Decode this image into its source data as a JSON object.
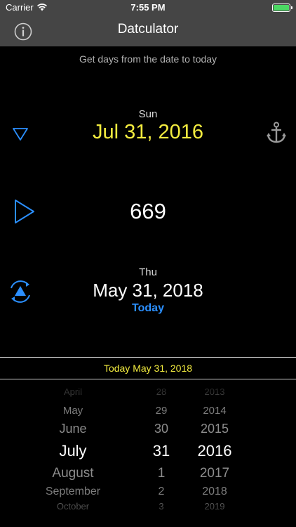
{
  "status_bar": {
    "carrier": "Carrier",
    "time": "7:55 PM",
    "battery_color": "#4cd964"
  },
  "nav_bar": {
    "title": "Datculator",
    "left_icon": "info-icon"
  },
  "subtitle": "Get days from the date to today",
  "start": {
    "weekday": "Sun",
    "date": "Jul 31, 2016",
    "left_icon": "down-triangle-icon",
    "right_icon": "anchor-icon"
  },
  "result": {
    "days": "669",
    "icon": "play-icon"
  },
  "end": {
    "weekday": "Thu",
    "date": "May 31, 2018",
    "today_label": "Today",
    "icon": "refresh-up-icon"
  },
  "today_bar": {
    "text": "Today May 31, 2018"
  },
  "picker": {
    "rows": [
      {
        "month": "April",
        "day": "28",
        "year": "2013"
      },
      {
        "month": "May",
        "day": "29",
        "year": "2014"
      },
      {
        "month": "June",
        "day": "30",
        "year": "2015"
      },
      {
        "month": "July",
        "day": "31",
        "year": "2016"
      },
      {
        "month": "August",
        "day": "1",
        "year": "2017"
      },
      {
        "month": "September",
        "day": "2",
        "year": "2018"
      },
      {
        "month": "October",
        "day": "3",
        "year": "2019"
      }
    ],
    "selected_index": 3
  },
  "colors": {
    "accent_blue": "#2b8fff",
    "highlight_yellow": "#f3ec3f",
    "nav_gray": "#454545"
  }
}
